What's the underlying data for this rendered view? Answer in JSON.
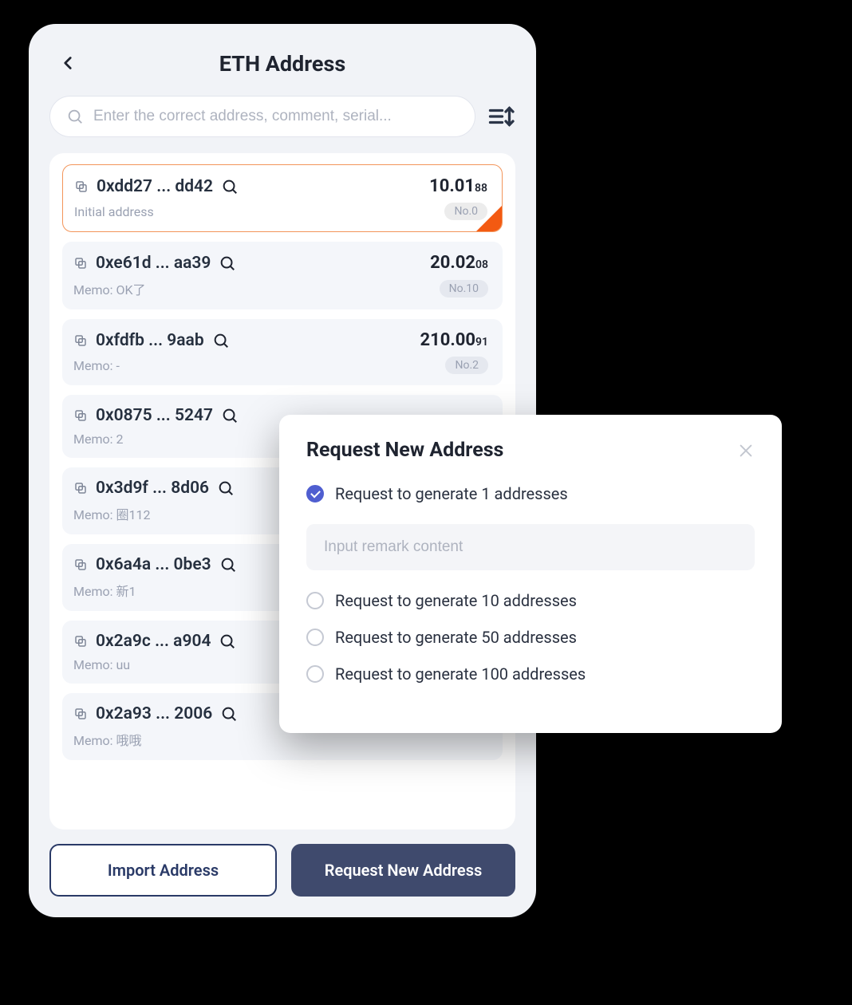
{
  "header": {
    "title": "ETH Address"
  },
  "search": {
    "placeholder": "Enter the correct address, comment, serial..."
  },
  "addresses": [
    {
      "addr": "0xdd27 ... dd42",
      "balance_main": "10.01",
      "balance_dec": "88",
      "memo": "Initial address",
      "no": "No.0",
      "selected": true
    },
    {
      "addr": "0xe61d ... aa39",
      "balance_main": "20.02",
      "balance_dec": "08",
      "memo": "Memo: OK了",
      "no": "No.10",
      "selected": false
    },
    {
      "addr": "0xfdfb ... 9aab",
      "balance_main": "210.00",
      "balance_dec": "91",
      "memo": "Memo: -",
      "no": "No.2",
      "selected": false
    },
    {
      "addr": "0x0875 ... 5247",
      "balance_main": "",
      "balance_dec": "",
      "memo": "Memo: 2",
      "no": "",
      "selected": false
    },
    {
      "addr": "0x3d9f ... 8d06",
      "balance_main": "",
      "balance_dec": "",
      "memo": "Memo: 圈112",
      "no": "",
      "selected": false
    },
    {
      "addr": "0x6a4a ... 0be3",
      "balance_main": "",
      "balance_dec": "",
      "memo": "Memo: 新1",
      "no": "",
      "selected": false
    },
    {
      "addr": "0x2a9c ... a904",
      "balance_main": "",
      "balance_dec": "",
      "memo": "Memo: uu",
      "no": "",
      "selected": false
    },
    {
      "addr": "0x2a93 ... 2006",
      "balance_main": "",
      "balance_dec": "",
      "memo": "Memo: 哦哦",
      "no": "",
      "selected": false
    }
  ],
  "buttons": {
    "import": "Import Address",
    "request": "Request New Address"
  },
  "modal": {
    "title": "Request New Address",
    "remark_placeholder": "Input remark content",
    "options": [
      {
        "label": "Request to generate 1 addresses",
        "checked": true
      },
      {
        "label": "Request to generate 10 addresses",
        "checked": false
      },
      {
        "label": "Request to generate 50 addresses",
        "checked": false
      },
      {
        "label": "Request to generate 100 addresses",
        "checked": false
      }
    ]
  }
}
